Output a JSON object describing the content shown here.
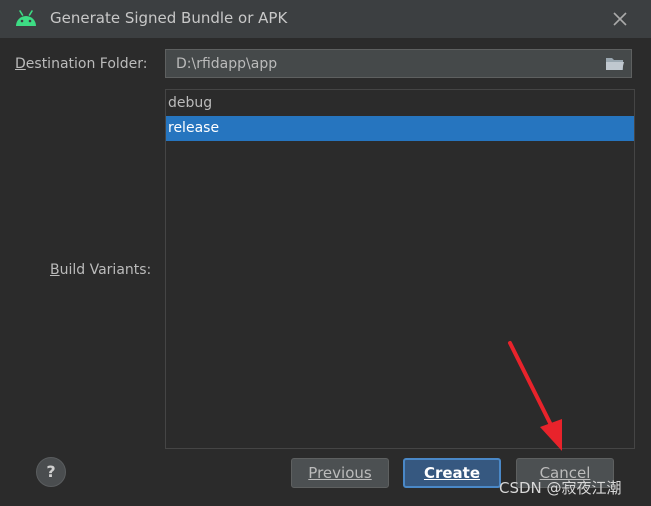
{
  "window": {
    "title": "Generate Signed Bundle or APK",
    "app_icon": "android-icon",
    "close_icon": "close-icon"
  },
  "destination": {
    "label_prefix": "",
    "label_mnemonic": "D",
    "label_rest": "estination Folder:",
    "value": "D:\\rfidapp\\app",
    "browse_icon": "folder-icon"
  },
  "build_variants": {
    "label_mnemonic": "B",
    "label_rest": "uild Variants:",
    "items": [
      {
        "label": "debug",
        "selected": false
      },
      {
        "label": "release",
        "selected": true
      }
    ],
    "selected_color": "#2675bf"
  },
  "buttons": {
    "help_label": "?",
    "previous_label": "Previous",
    "create_label": "Create",
    "cancel_label": "Cancel"
  },
  "annotation": {
    "arrow_color": "#e8232b",
    "watermark": "CSDN @寂夜江潮"
  }
}
